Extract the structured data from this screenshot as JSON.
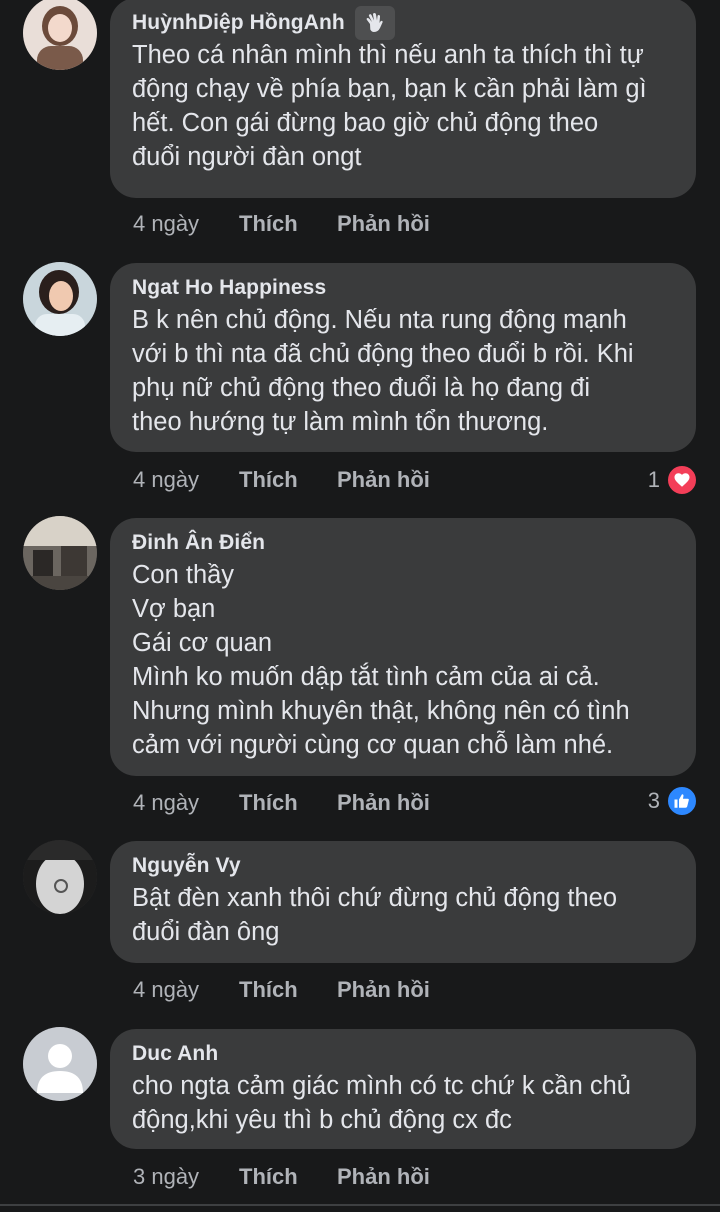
{
  "comments": [
    {
      "name": "HuỳnhDiệp HồngAnh",
      "badge_icon": "waving-hand-icon",
      "lines": [
        "Theo cá nhân mình thì nếu anh ta thích thì tự",
        "động chạy về phía bạn, bạn k cần phải làm gì",
        "hết. Con gái đừng bao giờ chủ động theo",
        "đuổi người đàn ongt"
      ],
      "time": "4 ngày",
      "like_label": "Thích",
      "reply_label": "Phản hồi"
    },
    {
      "name": "Ngat Ho Happiness",
      "lines": [
        "B k nên chủ động. Nếu nta rung động mạnh",
        "với b thì nta đã chủ động theo đuổi b rồi. Khi",
        "phụ nữ chủ động theo đuổi là họ đang đi",
        "theo hướng tự làm mình tổn thương."
      ],
      "time": "4 ngày",
      "like_label": "Thích",
      "reply_label": "Phản hồi",
      "reaction_count": "1",
      "reaction_icon": "heart-icon",
      "reaction_color": "#f33e58"
    },
    {
      "name": "Đinh Ân Điển",
      "lines": [
        "Con thầy",
        "Vợ bạn",
        "Gái cơ quan",
        "Mình ko muốn dập tắt tình cảm của ai cả.",
        "Nhưng mình khuyên thật, không nên có tình",
        "cảm với người cùng cơ quan chỗ làm nhé."
      ],
      "time": "4 ngày",
      "like_label": "Thích",
      "reply_label": "Phản hồi",
      "reaction_count": "3",
      "reaction_icon": "thumbs-up-icon",
      "reaction_color": "#2d88ff"
    },
    {
      "name": "Nguyễn Vy",
      "lines": [
        "Bật đèn xanh thôi chứ đừng chủ động theo",
        "đuổi đàn ông"
      ],
      "time": "4 ngày",
      "like_label": "Thích",
      "reply_label": "Phản hồi"
    },
    {
      "name": "Duc Anh",
      "lines": [
        "cho ngta cảm giác mình có tc chứ k cần chủ",
        "động,khi yêu thì b chủ động cx đc"
      ],
      "time": "3 ngày",
      "like_label": "Thích",
      "reply_label": "Phản hồi"
    }
  ]
}
